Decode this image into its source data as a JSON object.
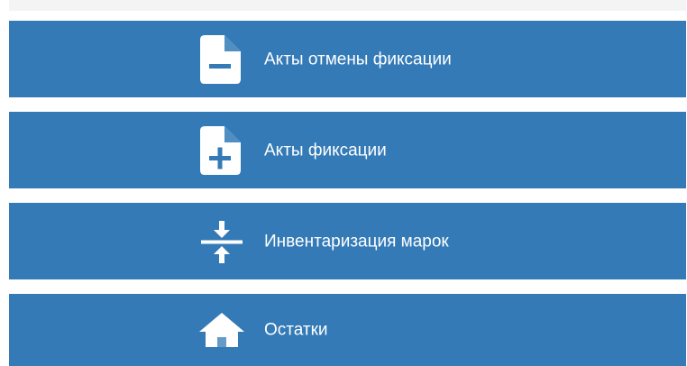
{
  "menu": {
    "items": [
      {
        "label": "Акты отмены фиксации",
        "icon": "document-minus-icon"
      },
      {
        "label": "Акты фиксации",
        "icon": "document-plus-icon"
      },
      {
        "label": "Инвентаризация марок",
        "icon": "compress-arrows-icon"
      },
      {
        "label": "Остатки",
        "icon": "home-icon"
      }
    ]
  },
  "colors": {
    "tile_background": "#337ab7",
    "text": "#ffffff",
    "top_strip": "#f4f4f4"
  }
}
